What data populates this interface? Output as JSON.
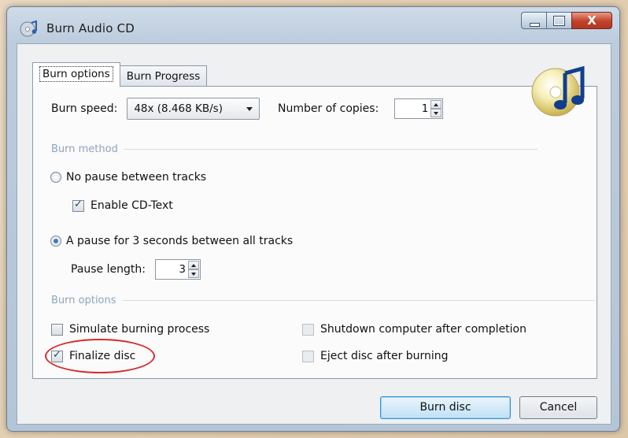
{
  "window": {
    "title": "Burn Audio CD",
    "close_glyph": "X"
  },
  "tabs": [
    {
      "label": "Burn options",
      "active": true
    },
    {
      "label": "Burn Progress",
      "active": false
    }
  ],
  "burn_speed": {
    "label": "Burn speed:",
    "value": "48x (8.468 KB/s)"
  },
  "copies": {
    "label": "Number of copies:",
    "value": "1"
  },
  "burn_method": {
    "group_label": "Burn method",
    "no_pause": {
      "label": "No pause between tracks",
      "selected": false
    },
    "cd_text": {
      "label": "Enable CD-Text",
      "checked": true
    },
    "pause": {
      "label": "A pause for 3 seconds between all tracks",
      "selected": true
    },
    "pause_length": {
      "label": "Pause length:",
      "value": "3"
    }
  },
  "burn_options": {
    "group_label": "Burn options",
    "simulate": {
      "label": "Simulate burning process",
      "checked": false
    },
    "finalize": {
      "label": "Finalize disc",
      "checked": true
    },
    "shutdown": {
      "label": "Shutdown computer after completion",
      "checked": false
    },
    "eject": {
      "label": "Eject disc after burning",
      "checked": false
    }
  },
  "buttons": {
    "burn": "Burn disc",
    "cancel": "Cancel"
  },
  "colors": {
    "highlight": "#d62c2c",
    "group_title": "#8ea4bd"
  },
  "icons": {
    "app": "cd-app-icon",
    "disc": "cd-music-icon"
  }
}
